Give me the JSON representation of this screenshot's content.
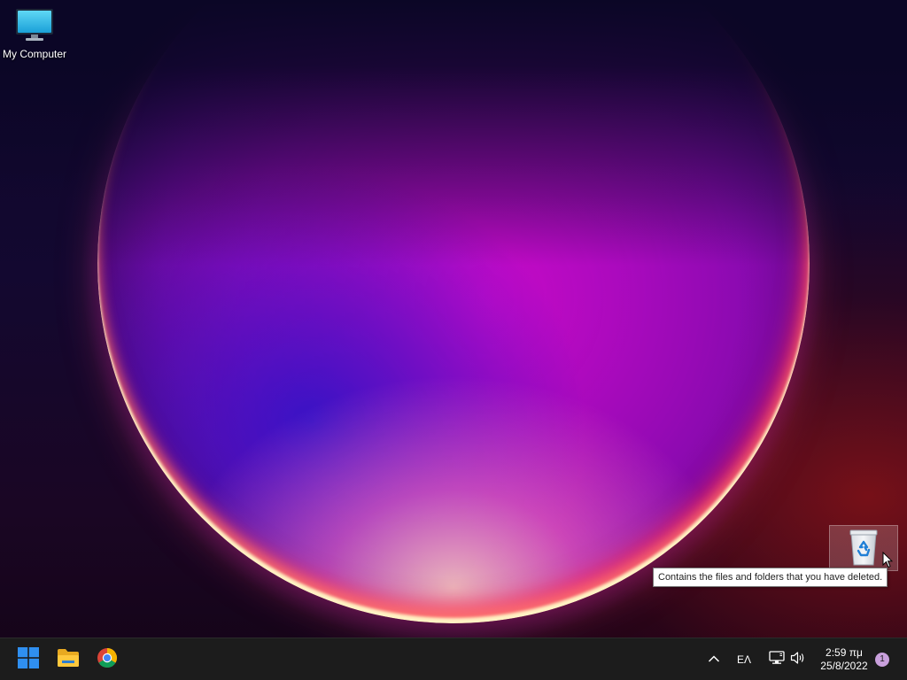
{
  "desktop": {
    "icons": [
      {
        "label": "My Computer",
        "icon": "computer-icon"
      },
      {
        "label": "",
        "icon": "recycle-bin-icon"
      }
    ],
    "tooltip": "Contains the files and folders that you have deleted."
  },
  "taskbar": {
    "pinned": [
      {
        "name": "Start",
        "icon": "windows-logo-icon"
      },
      {
        "name": "File Explorer",
        "icon": "folder-icon"
      },
      {
        "name": "Google Chrome",
        "icon": "chrome-icon"
      }
    ],
    "tray": {
      "language": "ΕΛ",
      "time": "2:59 πμ",
      "date": "25/8/2022",
      "notification_count": "1"
    }
  },
  "colors": {
    "accent_windows": "#2f8ff0",
    "taskbar_bg": "#1c1c1c",
    "notification_badge": "#c9a0dc"
  }
}
